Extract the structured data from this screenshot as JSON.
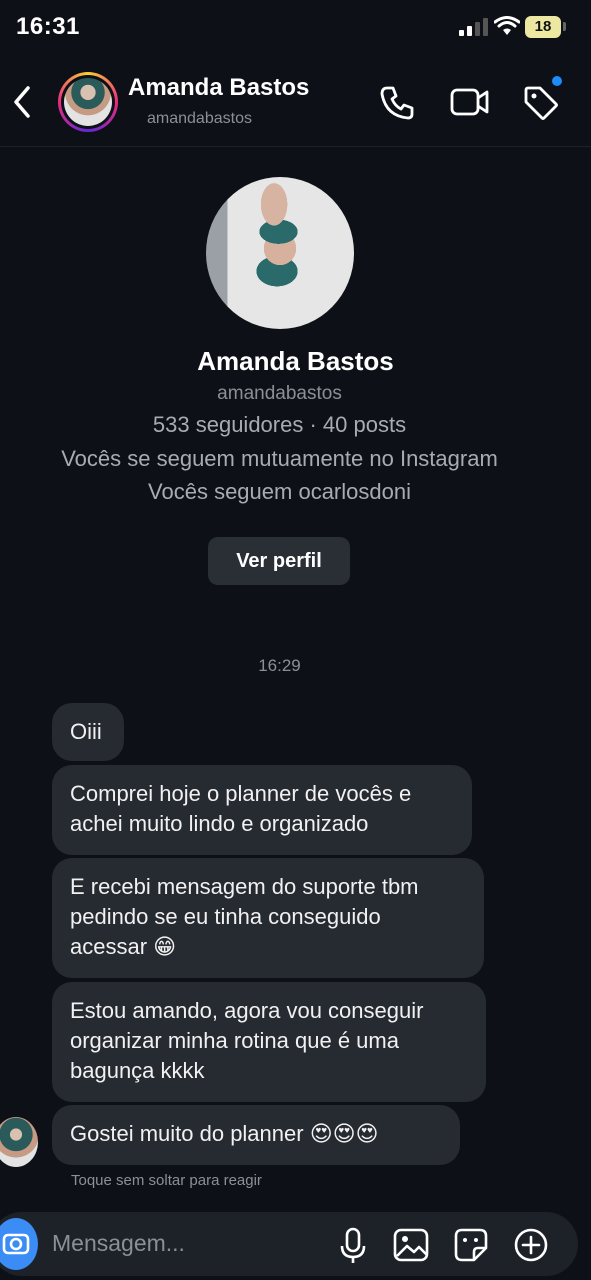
{
  "status": {
    "time": "16:31",
    "battery": "18"
  },
  "header": {
    "name": "Amanda Bastos",
    "username": "amandabastos"
  },
  "profile": {
    "name": "Amanda Bastos",
    "username": "amandabastos",
    "stats": "533 seguidores · 40 posts",
    "mutual": "Vocês se seguem mutuamente no Instagram",
    "follow": "Vocês seguem ocarlosdoni",
    "button": "Ver perfil"
  },
  "chat": {
    "timestamp": "16:29",
    "messages": [
      "Oiii",
      "Comprei hoje o planner de vocês e\nachei muito lindo e organizado",
      "E recebi mensagem do suporte tbm\npedindo se eu tinha conseguido\nacessar 😁",
      "Estou amando, agora vou conseguir\norganizar minha rotina que é uma\nbagunça kkkk",
      "Gostei muito do planner 😍😍😍"
    ],
    "hint": "Toque sem soltar para reagir"
  },
  "composer": {
    "placeholder": "Mensagem..."
  },
  "colors": {
    "background": "#0d1117",
    "bubble": "#262a31",
    "accent": "#3b8cf5",
    "notification": "#1d8cf8"
  },
  "icons": [
    "back-icon",
    "phone-icon",
    "video-icon",
    "tag-icon",
    "camera-icon",
    "microphone-icon",
    "gallery-icon",
    "sticker-icon",
    "plus-icon"
  ]
}
